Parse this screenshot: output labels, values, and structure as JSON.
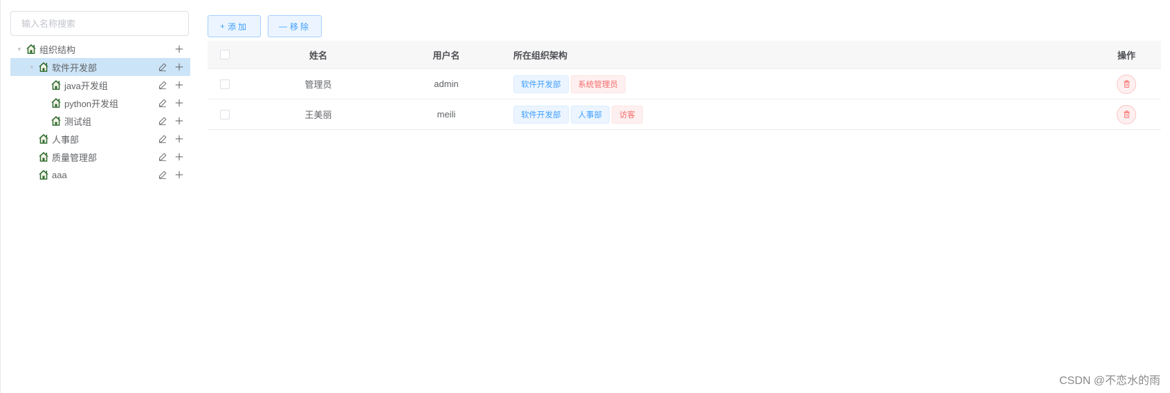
{
  "search": {
    "placeholder": "输入名称搜索"
  },
  "tree": {
    "root": {
      "label": "组织结构"
    },
    "software": {
      "label": "软件开发部"
    },
    "java": {
      "label": "java开发组"
    },
    "python": {
      "label": "python开发组"
    },
    "test": {
      "label": "测试组"
    },
    "hr": {
      "label": "人事部"
    },
    "quality": {
      "label": "质量管理部"
    },
    "aaa": {
      "label": "aaa"
    }
  },
  "toolbar": {
    "add_icon": "+",
    "add_label": "添加",
    "remove_icon": "—",
    "remove_label": "移除"
  },
  "table": {
    "headers": {
      "name": "姓名",
      "username": "用户名",
      "org": "所在组织架构",
      "action": "操作"
    },
    "rows": [
      {
        "name": "管理员",
        "username": "admin",
        "tags": [
          "软件开发部",
          "系统管理员"
        ]
      },
      {
        "name": "王美丽",
        "username": "meili",
        "tags": [
          "软件开发部",
          "人事部",
          "访客"
        ]
      }
    ]
  },
  "watermark": "CSDN @不恋水的雨",
  "colors": {
    "primary": "#409eff",
    "danger": "#f56c6c",
    "selected_bg": "#cce4f7"
  },
  "icons": [
    "home-icon",
    "edit-icon",
    "plus-icon",
    "delete-icon",
    "caret-down-icon"
  ]
}
